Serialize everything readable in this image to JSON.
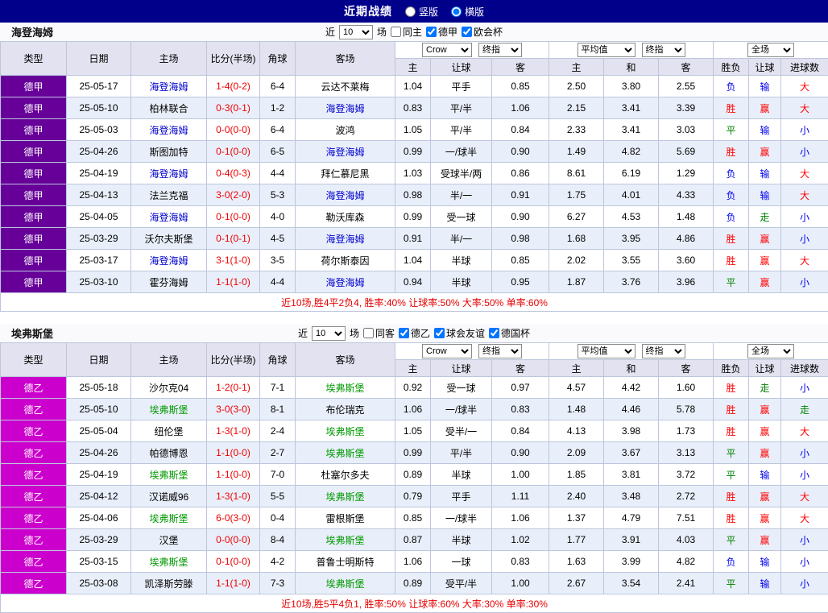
{
  "topbar": {
    "title": "近期战绩",
    "layout_options": [
      {
        "label": "竖版",
        "selected": false
      },
      {
        "label": "横版",
        "selected": true
      }
    ]
  },
  "table_headers": {
    "left": [
      "类型",
      "日期",
      "主场",
      "比分(半场)",
      "角球",
      "客场"
    ],
    "sub": [
      "主",
      "让球",
      "客",
      "主",
      "和",
      "客",
      "胜负",
      "让球",
      "进球数"
    ]
  },
  "result_colors": {
    "win": "#FF0000",
    "draw": "#008000",
    "loss": "#0000EE"
  },
  "sections": [
    {
      "team": "海登海姆",
      "team_class": "t1",
      "league_style": {
        "bg": "#660099",
        "fg": "#FFFFFF"
      },
      "filters": {
        "prefix": "近",
        "count": "10",
        "suffix": "场",
        "checks": [
          {
            "label": "同主",
            "checked": false
          },
          {
            "label": "德甲",
            "checked": true
          },
          {
            "label": "欧会杯",
            "checked": true
          }
        ]
      },
      "dropdowns": {
        "group1": [
          "Crow",
          "终指"
        ],
        "group2": [
          "平均值",
          "终指"
        ],
        "group3": [
          "全场"
        ]
      },
      "rows": [
        {
          "league": "德甲",
          "date": "25-05-17",
          "home": "海登海姆",
          "home_cls": "t1",
          "score": "1-4(0-2)",
          "corners": "6-4",
          "away": "云达不莱梅",
          "away_cls": "",
          "odds": [
            "1.04",
            "平手",
            "0.85"
          ],
          "avg": [
            "2.50",
            "3.80",
            "2.55"
          ],
          "results": [
            [
              "负",
              "loss"
            ],
            [
              "输",
              "loss"
            ],
            [
              "大",
              "win"
            ]
          ]
        },
        {
          "league": "德甲",
          "date": "25-05-10",
          "home": "柏林联合",
          "home_cls": "",
          "score": "0-3(0-1)",
          "corners": "1-2",
          "away": "海登海姆",
          "away_cls": "t1",
          "odds": [
            "0.83",
            "平/半",
            "1.06"
          ],
          "avg": [
            "2.15",
            "3.41",
            "3.39"
          ],
          "results": [
            [
              "胜",
              "win"
            ],
            [
              "赢",
              "win"
            ],
            [
              "大",
              "win"
            ]
          ]
        },
        {
          "league": "德甲",
          "date": "25-05-03",
          "home": "海登海姆",
          "home_cls": "t1",
          "score": "0-0(0-0)",
          "corners": "6-4",
          "away": "波鸿",
          "away_cls": "",
          "odds": [
            "1.05",
            "平/半",
            "0.84"
          ],
          "avg": [
            "2.33",
            "3.41",
            "3.03"
          ],
          "results": [
            [
              "平",
              "draw"
            ],
            [
              "输",
              "loss"
            ],
            [
              "小",
              "loss"
            ]
          ]
        },
        {
          "league": "德甲",
          "date": "25-04-26",
          "home": "斯图加特",
          "home_cls": "",
          "score": "0-1(0-0)",
          "corners": "6-5",
          "away": "海登海姆",
          "away_cls": "t1",
          "odds": [
            "0.99",
            "一/球半",
            "0.90"
          ],
          "avg": [
            "1.49",
            "4.82",
            "5.69"
          ],
          "results": [
            [
              "胜",
              "win"
            ],
            [
              "赢",
              "win"
            ],
            [
              "小",
              "loss"
            ]
          ]
        },
        {
          "league": "德甲",
          "date": "25-04-19",
          "home": "海登海姆",
          "home_cls": "t1",
          "score": "0-4(0-3)",
          "corners": "4-4",
          "away": "拜仁慕尼黑",
          "away_cls": "",
          "odds": [
            "1.03",
            "受球半/两",
            "0.86"
          ],
          "avg": [
            "8.61",
            "6.19",
            "1.29"
          ],
          "results": [
            [
              "负",
              "loss"
            ],
            [
              "输",
              "loss"
            ],
            [
              "大",
              "win"
            ]
          ]
        },
        {
          "league": "德甲",
          "date": "25-04-13",
          "home": "法兰克福",
          "home_cls": "",
          "score": "3-0(2-0)",
          "corners": "5-3",
          "away": "海登海姆",
          "away_cls": "t1",
          "odds": [
            "0.98",
            "半/一",
            "0.91"
          ],
          "avg": [
            "1.75",
            "4.01",
            "4.33"
          ],
          "results": [
            [
              "负",
              "loss"
            ],
            [
              "输",
              "loss"
            ],
            [
              "大",
              "win"
            ]
          ]
        },
        {
          "league": "德甲",
          "date": "25-04-05",
          "home": "海登海姆",
          "home_cls": "t1",
          "score": "0-1(0-0)",
          "corners": "4-0",
          "away": "勒沃库森",
          "away_cls": "",
          "odds": [
            "0.99",
            "受一球",
            "0.90"
          ],
          "avg": [
            "6.27",
            "4.53",
            "1.48"
          ],
          "results": [
            [
              "负",
              "loss"
            ],
            [
              "走",
              "draw"
            ],
            [
              "小",
              "loss"
            ]
          ]
        },
        {
          "league": "德甲",
          "date": "25-03-29",
          "home": "沃尔夫斯堡",
          "home_cls": "",
          "score": "0-1(0-1)",
          "corners": "4-5",
          "away": "海登海姆",
          "away_cls": "t1",
          "odds": [
            "0.91",
            "半/一",
            "0.98"
          ],
          "avg": [
            "1.68",
            "3.95",
            "4.86"
          ],
          "results": [
            [
              "胜",
              "win"
            ],
            [
              "赢",
              "win"
            ],
            [
              "小",
              "loss"
            ]
          ]
        },
        {
          "league": "德甲",
          "date": "25-03-17",
          "home": "海登海姆",
          "home_cls": "t1",
          "score": "3-1(1-0)",
          "corners": "3-5",
          "away": "荷尔斯泰因",
          "away_cls": "",
          "odds": [
            "1.04",
            "半球",
            "0.85"
          ],
          "avg": [
            "2.02",
            "3.55",
            "3.60"
          ],
          "results": [
            [
              "胜",
              "win"
            ],
            [
              "赢",
              "win"
            ],
            [
              "大",
              "win"
            ]
          ]
        },
        {
          "league": "德甲",
          "date": "25-03-10",
          "home": "霍芬海姆",
          "home_cls": "",
          "score": "1-1(1-0)",
          "corners": "4-4",
          "away": "海登海姆",
          "away_cls": "t1",
          "odds": [
            "0.94",
            "半球",
            "0.95"
          ],
          "avg": [
            "1.87",
            "3.76",
            "3.96"
          ],
          "results": [
            [
              "平",
              "draw"
            ],
            [
              "赢",
              "win"
            ],
            [
              "小",
              "loss"
            ]
          ]
        }
      ],
      "summary": "近10场,胜4平2负4, 胜率:40% 让球率:50% 大率:50% 单率:60%"
    },
    {
      "team": "埃弗斯堡",
      "team_class": "t2",
      "league_style": {
        "bg": "#CC00CC",
        "fg": "#FFFFFF"
      },
      "filters": {
        "prefix": "近",
        "count": "10",
        "suffix": "场",
        "checks": [
          {
            "label": "同客",
            "checked": false
          },
          {
            "label": "德乙",
            "checked": true
          },
          {
            "label": "球会友谊",
            "checked": true
          },
          {
            "label": "德国杯",
            "checked": true
          }
        ]
      },
      "dropdowns": {
        "group1": [
          "Crow",
          "终指"
        ],
        "group2": [
          "平均值",
          "终指"
        ],
        "group3": [
          "全场"
        ]
      },
      "rows": [
        {
          "league": "德乙",
          "date": "25-05-18",
          "home": "沙尔克04",
          "home_cls": "",
          "score": "1-2(0-1)",
          "corners": "7-1",
          "away": "埃弗斯堡",
          "away_cls": "t2",
          "odds": [
            "0.92",
            "受一球",
            "0.97"
          ],
          "avg": [
            "4.57",
            "4.42",
            "1.60"
          ],
          "results": [
            [
              "胜",
              "win"
            ],
            [
              "走",
              "draw"
            ],
            [
              "小",
              "loss"
            ]
          ]
        },
        {
          "league": "德乙",
          "date": "25-05-10",
          "home": "埃弗斯堡",
          "home_cls": "t2",
          "score": "3-0(3-0)",
          "corners": "8-1",
          "away": "布伦瑞克",
          "away_cls": "",
          "odds": [
            "1.06",
            "一/球半",
            "0.83"
          ],
          "avg": [
            "1.48",
            "4.46",
            "5.78"
          ],
          "results": [
            [
              "胜",
              "win"
            ],
            [
              "赢",
              "win"
            ],
            [
              "走",
              "draw"
            ]
          ]
        },
        {
          "league": "德乙",
          "date": "25-05-04",
          "home": "纽伦堡",
          "home_cls": "",
          "score": "1-3(1-0)",
          "corners": "2-4",
          "away": "埃弗斯堡",
          "away_cls": "t2",
          "odds": [
            "1.05",
            "受半/一",
            "0.84"
          ],
          "avg": [
            "4.13",
            "3.98",
            "1.73"
          ],
          "results": [
            [
              "胜",
              "win"
            ],
            [
              "赢",
              "win"
            ],
            [
              "大",
              "win"
            ]
          ]
        },
        {
          "league": "德乙",
          "date": "25-04-26",
          "home": "帕德博恩",
          "home_cls": "",
          "score": "1-1(0-0)",
          "corners": "2-7",
          "away": "埃弗斯堡",
          "away_cls": "t2",
          "odds": [
            "0.99",
            "平/半",
            "0.90"
          ],
          "avg": [
            "2.09",
            "3.67",
            "3.13"
          ],
          "results": [
            [
              "平",
              "draw"
            ],
            [
              "赢",
              "win"
            ],
            [
              "小",
              "loss"
            ]
          ]
        },
        {
          "league": "德乙",
          "date": "25-04-19",
          "home": "埃弗斯堡",
          "home_cls": "t2",
          "score": "1-1(0-0)",
          "corners": "7-0",
          "away": "杜塞尔多夫",
          "away_cls": "",
          "odds": [
            "0.89",
            "半球",
            "1.00"
          ],
          "avg": [
            "1.85",
            "3.81",
            "3.72"
          ],
          "results": [
            [
              "平",
              "draw"
            ],
            [
              "输",
              "loss"
            ],
            [
              "小",
              "loss"
            ]
          ]
        },
        {
          "league": "德乙",
          "date": "25-04-12",
          "home": "汉诺威96",
          "home_cls": "",
          "score": "1-3(1-0)",
          "corners": "5-5",
          "away": "埃弗斯堡",
          "away_cls": "t2",
          "odds": [
            "0.79",
            "平手",
            "1.11"
          ],
          "avg": [
            "2.40",
            "3.48",
            "2.72"
          ],
          "results": [
            [
              "胜",
              "win"
            ],
            [
              "赢",
              "win"
            ],
            [
              "大",
              "win"
            ]
          ]
        },
        {
          "league": "德乙",
          "date": "25-04-06",
          "home": "埃弗斯堡",
          "home_cls": "t2",
          "score": "6-0(3-0)",
          "corners": "0-4",
          "away": "雷根斯堡",
          "away_cls": "",
          "odds": [
            "0.85",
            "一/球半",
            "1.06"
          ],
          "avg": [
            "1.37",
            "4.79",
            "7.51"
          ],
          "results": [
            [
              "胜",
              "win"
            ],
            [
              "赢",
              "win"
            ],
            [
              "大",
              "win"
            ]
          ]
        },
        {
          "league": "德乙",
          "date": "25-03-29",
          "home": "汉堡",
          "home_cls": "",
          "score": "0-0(0-0)",
          "corners": "8-4",
          "away": "埃弗斯堡",
          "away_cls": "t2",
          "odds": [
            "0.87",
            "半球",
            "1.02"
          ],
          "avg": [
            "1.77",
            "3.91",
            "4.03"
          ],
          "results": [
            [
              "平",
              "draw"
            ],
            [
              "赢",
              "win"
            ],
            [
              "小",
              "loss"
            ]
          ]
        },
        {
          "league": "德乙",
          "date": "25-03-15",
          "home": "埃弗斯堡",
          "home_cls": "t2",
          "score": "0-1(0-0)",
          "corners": "4-2",
          "away": "普鲁士明斯特",
          "away_cls": "",
          "odds": [
            "1.06",
            "一球",
            "0.83"
          ],
          "avg": [
            "1.63",
            "3.99",
            "4.82"
          ],
          "results": [
            [
              "负",
              "loss"
            ],
            [
              "输",
              "loss"
            ],
            [
              "小",
              "loss"
            ]
          ]
        },
        {
          "league": "德乙",
          "date": "25-03-08",
          "home": "凯泽斯劳滕",
          "home_cls": "",
          "score": "1-1(1-0)",
          "corners": "7-3",
          "away": "埃弗斯堡",
          "away_cls": "t2",
          "odds": [
            "0.89",
            "受平/半",
            "1.00"
          ],
          "avg": [
            "2.67",
            "3.54",
            "2.41"
          ],
          "results": [
            [
              "平",
              "draw"
            ],
            [
              "输",
              "loss"
            ],
            [
              "小",
              "loss"
            ]
          ]
        }
      ],
      "summary": "近10场,胜5平4负1, 胜率:50% 让球率:60% 大率:30% 单率:30%"
    }
  ]
}
